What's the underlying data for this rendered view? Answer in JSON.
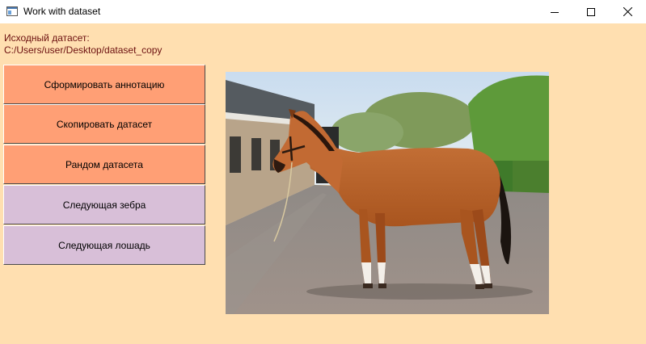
{
  "window": {
    "title": "Work with dataset"
  },
  "dataset": {
    "label": "Исходный датасет:",
    "path": "C:/Users/user/Desktop/dataset_copy"
  },
  "buttons": {
    "annotate": "Сформировать аннотацию",
    "copy": "Скопировать датасет",
    "random": "Рандом датасета",
    "next_zebra": "Следующая зебра",
    "next_horse": "Следующая лошадь"
  },
  "image": {
    "subject": "horse"
  },
  "colors": {
    "background": "#ffdfb0",
    "primary_button": "#ff9f75",
    "secondary_button": "#d8bfd8",
    "info_text": "#6b0f0f"
  }
}
